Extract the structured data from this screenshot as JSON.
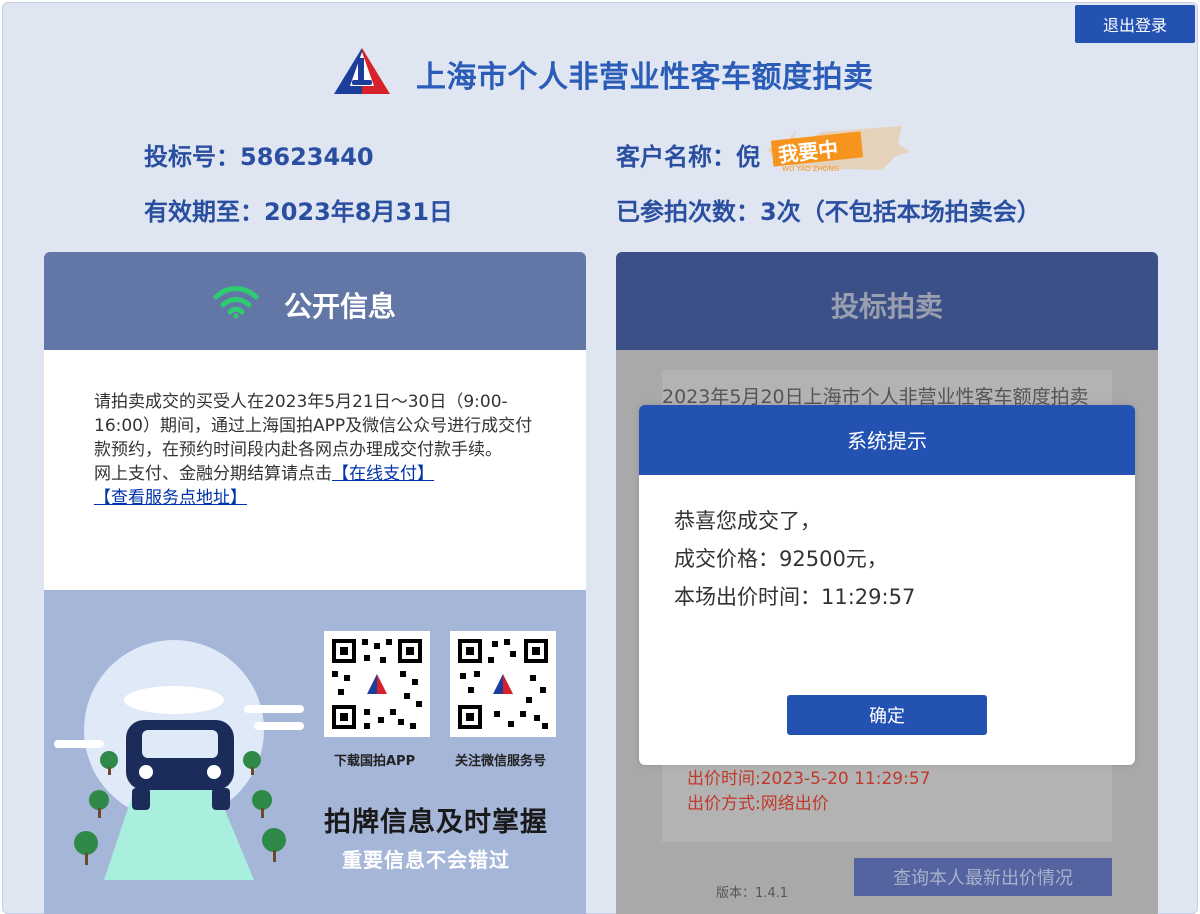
{
  "header": {
    "logout_label": "退出登录",
    "title": "上海市个人非营业性客车额度拍卖"
  },
  "user_info": {
    "bid_number": "投标号：58623440",
    "valid_until": "有效期至：2023年8月31日",
    "customer_name": "客户名称：倪",
    "participation_count": "已参拍次数：3次（不包括本场拍卖会）",
    "stamp_text": "我要中",
    "stamp_subtext": "WO YAO ZHONG"
  },
  "public_info": {
    "title": "公开信息",
    "notice": "请拍卖成交的买受人在2023年5月21日～30日（9:00-16:00）期间，通过上海国拍APP及微信公众号进行成交付款预约，在预约时间段内赴各网点办理成交付款手续。",
    "pay_prefix": "网上支付、金融分期结算请点击",
    "pay_link": "【在线支付】",
    "service_link": "【查看服务点地址】",
    "qr_app_caption": "下载国拍APP",
    "qr_wechat_caption": "关注微信服务号",
    "promo_headline": "拍牌信息及时掌握",
    "promo_subline": "重要信息不会错过"
  },
  "bidding": {
    "title": "投标拍卖",
    "session_text": "2023年5月20日上海市个人非营业性客车额度拍卖",
    "bid_time": "出价时间:2023-5-20 11:29:57",
    "bid_method": "出价方式:网络出价",
    "version": "版本：1.4.1",
    "query_button": "查询本人最新出价情况"
  },
  "modal": {
    "title": "系统提示",
    "line1": "恭喜您成交了，",
    "line2": "成交价格：92500元，",
    "line3": "本场出价时间：11:29:57",
    "ok_label": "确定"
  },
  "colors": {
    "primary": "#2452b3",
    "title_text": "#2a5cb8",
    "left_header": "#6377a6",
    "right_header": "#3b5087",
    "wifi_green": "#2ecc71"
  }
}
